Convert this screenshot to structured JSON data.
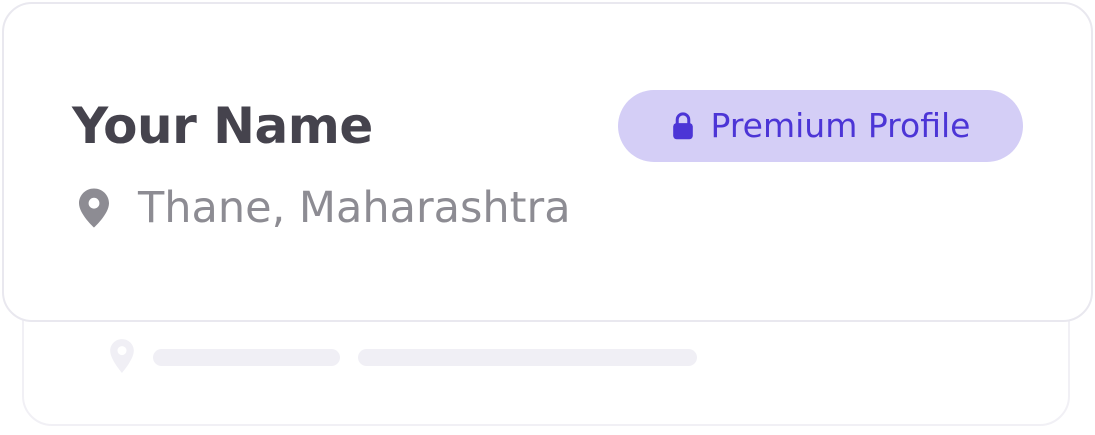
{
  "profile": {
    "name": "Your Name",
    "location": "Thane, Maharashtra",
    "badge_label": "Premium Profile"
  },
  "icons": {
    "location": "map-pin-icon",
    "badge": "lock-icon"
  },
  "colors": {
    "name_text": "#45434d",
    "location_text": "#8d8c93",
    "badge_background": "#d4cef6",
    "badge_text": "#4c35d6",
    "card_border": "#e9e8ef"
  }
}
